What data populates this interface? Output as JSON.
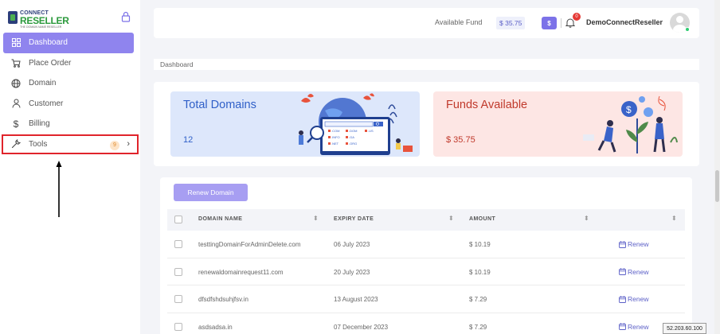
{
  "brand": {
    "line1": "CONNECT",
    "line2": "RESELLER",
    "tagline": "THE DOMAIN NAME RESELLER"
  },
  "sidebar": {
    "items": [
      {
        "label": "Dashboard",
        "icon": "dashboard-icon",
        "active": true
      },
      {
        "label": "Place Order",
        "icon": "cart-icon"
      },
      {
        "label": "Domain",
        "icon": "globe-icon"
      },
      {
        "label": "Customer",
        "icon": "user-icon"
      },
      {
        "label": "Billing",
        "icon": "dollar-icon"
      },
      {
        "label": "Tools",
        "icon": "wrench-icon",
        "badge": "9"
      }
    ]
  },
  "header": {
    "fund_label": "Available Fund",
    "fund_value": "$ 35.75",
    "dollar_button": "$",
    "notification_count": "0",
    "username": "DemoConnectReseller"
  },
  "breadcrumb": "Dashboard",
  "cards": {
    "total_domains": {
      "title": "Total Domains",
      "value": "12"
    },
    "funds_available": {
      "title": "Funds Available",
      "value": "$ 35.75"
    }
  },
  "table": {
    "renew_button": "Renew Domain",
    "columns": [
      "DOMAIN NAME",
      "EXPIRY DATE",
      "AMOUNT"
    ],
    "action_label": "Renew",
    "rows": [
      {
        "domain": "testtingDomainForAdminDelete.com",
        "expiry": "06 July 2023",
        "amount": "$ 10.19"
      },
      {
        "domain": "renewaldomainrequest11.com",
        "expiry": "20 July 2023",
        "amount": "$ 10.19"
      },
      {
        "domain": "dfsdfshdsuhjfsv.in",
        "expiry": "13 August 2023",
        "amount": "$ 7.29"
      },
      {
        "domain": "asdsadsa.in",
        "expiry": "07 December 2023",
        "amount": "$ 7.29"
      }
    ]
  },
  "illustration_tlds": [
    ".COM",
    ".DOM",
    ".US",
    ".INFO",
    ".GA",
    ".NET",
    ".ORG"
  ],
  "ip_address": "52.203.60.100",
  "colors": {
    "accent": "#8f84ee",
    "highlight_border": "#e0242b",
    "link": "#5b5fc7",
    "card_blue": "#dde7fb",
    "card_pink": "#fde6e4"
  }
}
